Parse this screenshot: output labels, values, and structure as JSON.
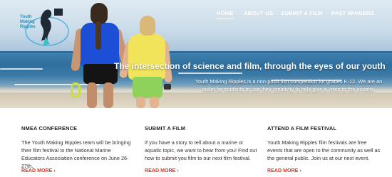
{
  "brand": {
    "logo_text": "Youth Making Ripples",
    "accent_color": "#2a8fbd",
    "link_color": "#e3331f"
  },
  "nav": {
    "items": [
      {
        "label": "HOME",
        "active": true
      },
      {
        "label": "ABOUT US",
        "active": false
      },
      {
        "label": "SUBMIT A FILM",
        "active": false
      },
      {
        "label": "PAST WINNERS",
        "active": false
      }
    ]
  },
  "hero": {
    "tagline": "The intersection of science and film, through the eyes of our youth",
    "description": "Youth Making Ripples is a non-profit film competition for grades K-12. We are an outlet for students to use their creativity to help give a voice to the oceans."
  },
  "columns": [
    {
      "title": "NMEA CONFERENCE",
      "body": "The Youth Making Ripples team will be bringing their film festival to the National Marine Educators Association conference on June 26-27th.",
      "link": "READ MORE"
    },
    {
      "title": "SUBMIT A FILM",
      "body": "If you have a story to tell about a marine or aquatic topic, we want to hear from you! Find out how to submit you film to our next film festival.",
      "link": "READ MORE"
    },
    {
      "title": "ATTEND A FILM FESTIVAL",
      "body": "Youth Making Ripples film festivals are free events that are open to the community as well as the general public. Join us at our next event.",
      "link": "READ MORE"
    }
  ]
}
